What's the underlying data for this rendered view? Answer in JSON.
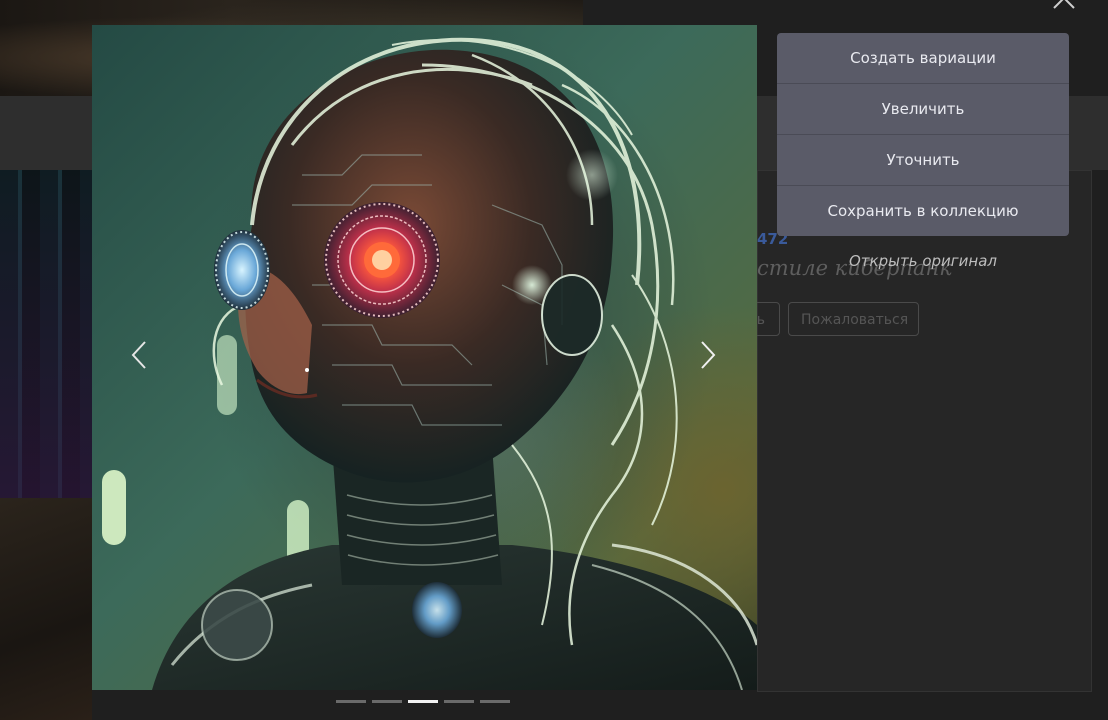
{
  "background": {
    "number_fragment": "472",
    "italic_fragment": "стиле киберпанк",
    "share_fragment": "ь",
    "report_label": "Пожаловаться"
  },
  "viewer": {
    "prev_icon": "chevron-left-icon",
    "next_icon": "chevron-right-icon",
    "close_icon": "close-icon",
    "indicators": 5,
    "active_index": 2
  },
  "actions": {
    "create_variations": "Создать вариации",
    "upscale": "Увеличить",
    "refine": "Уточнить",
    "save_to_collection": "Сохранить в коллекцию",
    "open_original": "Открыть оригинал"
  },
  "colors": {
    "menu_bg": "#5a5b68",
    "menu_text": "#e9eaf0",
    "indicator_active": "#f2f2f2",
    "indicator_inactive": "#6a6a6a"
  }
}
